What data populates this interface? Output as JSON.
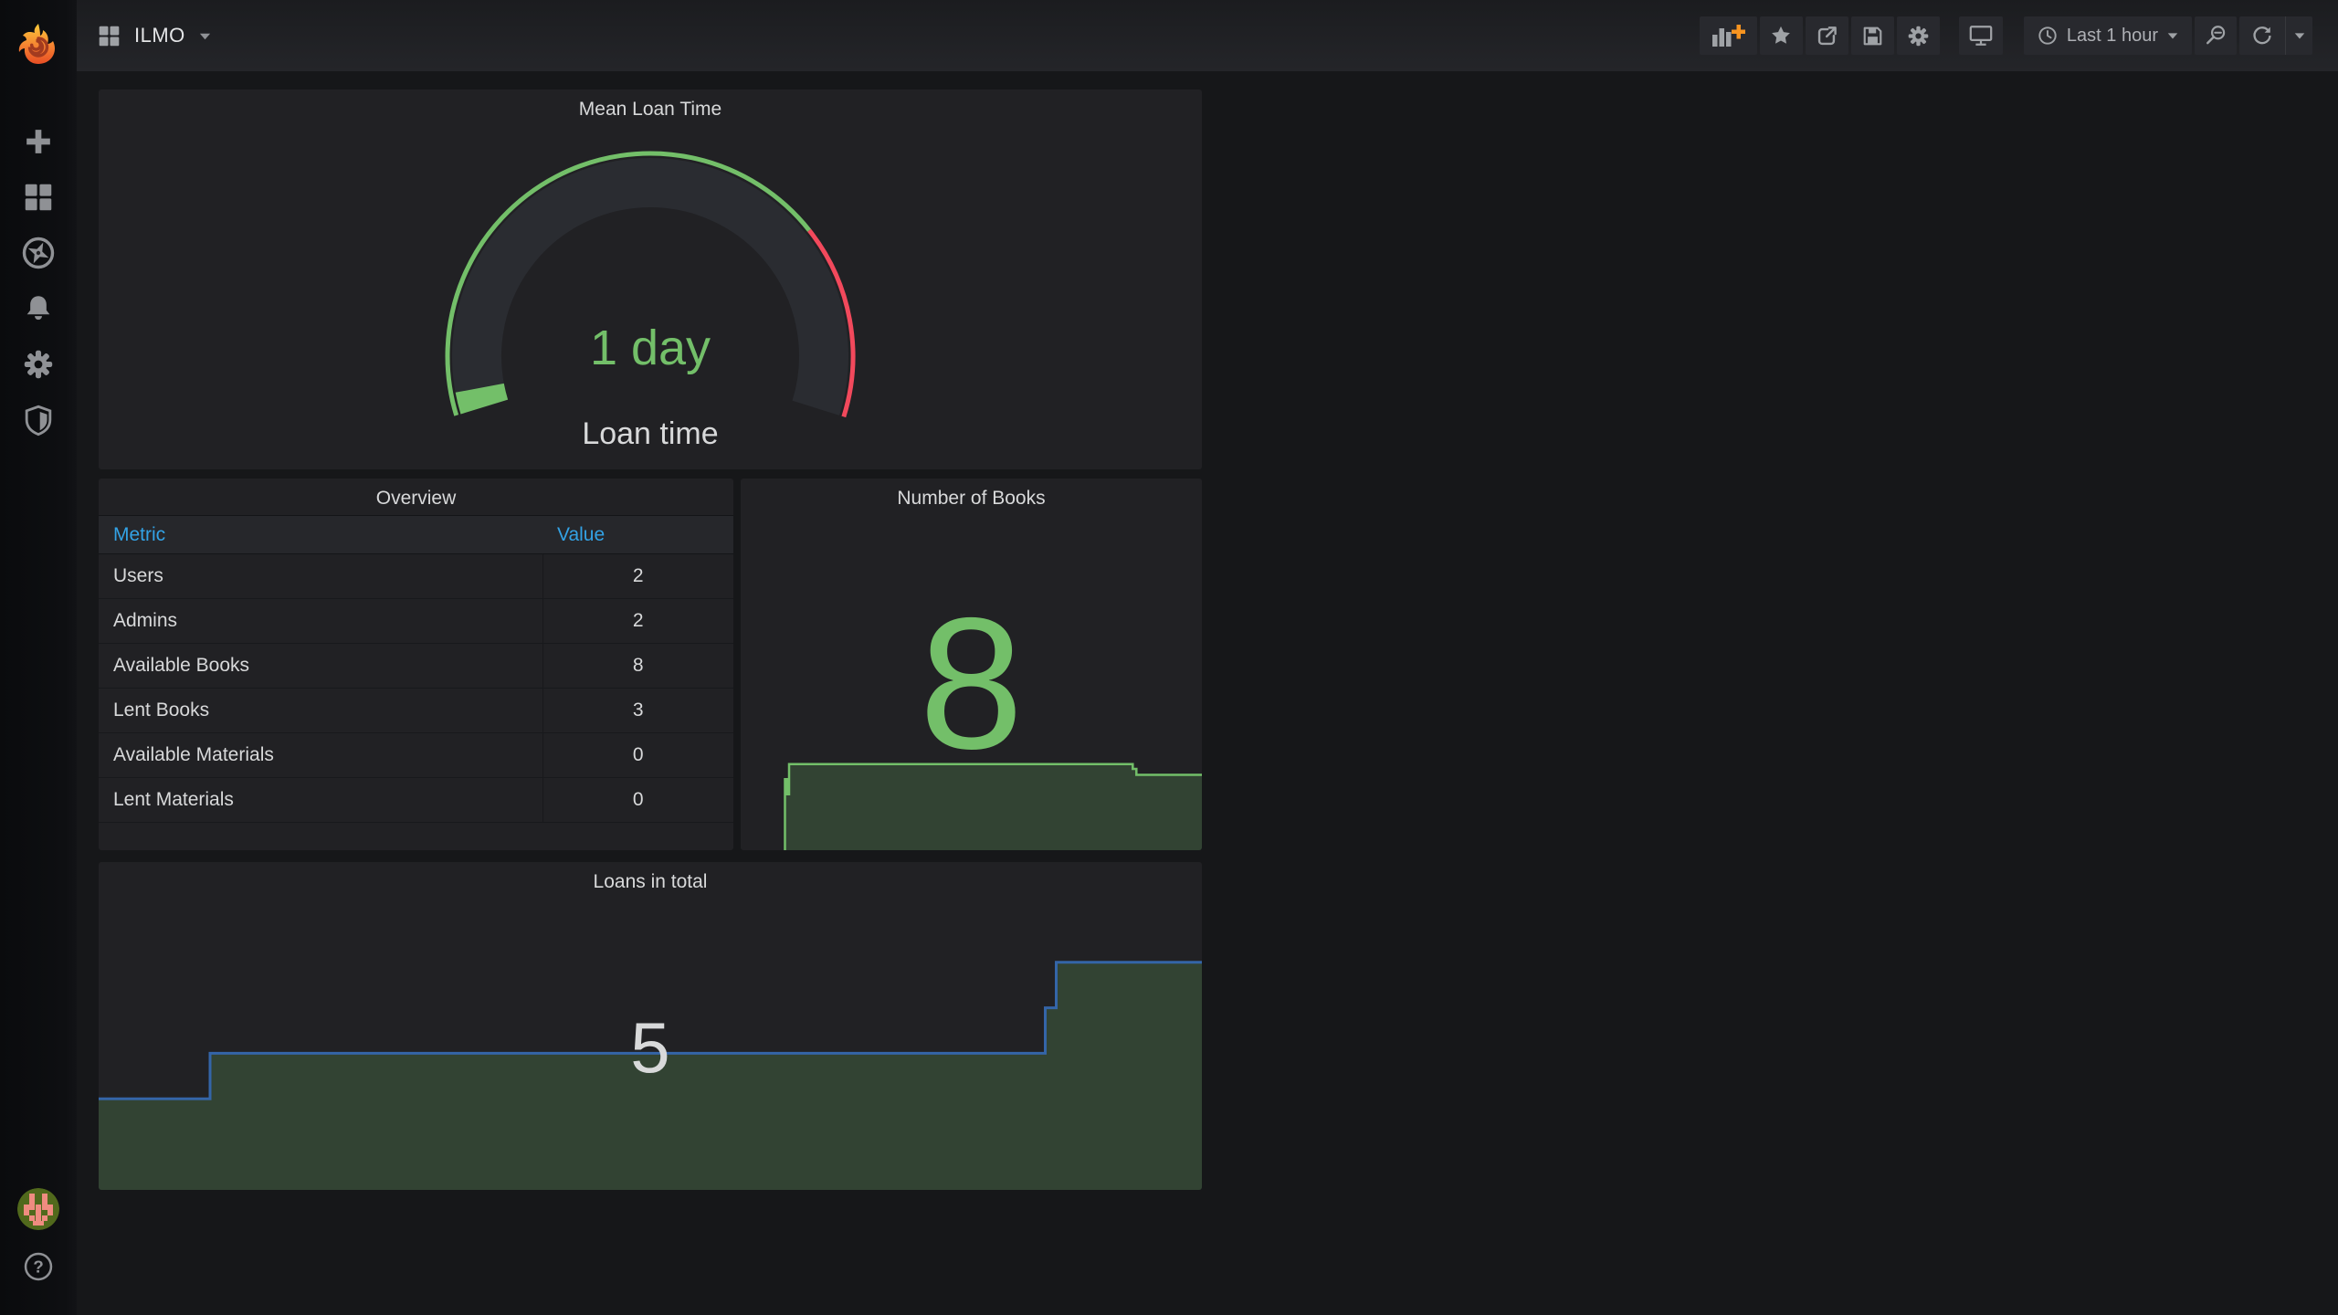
{
  "navbar": {
    "title": "ILMO",
    "time_picker_label": "Last 1 hour",
    "actions": [
      "add-panel",
      "mark-favorite",
      "share-dashboard",
      "save-dashboard",
      "dashboard-settings",
      "cycle-view-mode",
      "time-range-zoom-out",
      "refresh-dashboard",
      "refresh-interval-picker"
    ]
  },
  "sidebar": {
    "items": [
      "create",
      "dashboards",
      "explore",
      "alerting",
      "configuration",
      "server-admin"
    ],
    "bottom_items": [
      "user-avatar",
      "help"
    ]
  },
  "panels": {
    "gauge": {
      "title": "Mean Loan Time",
      "value": "1 day",
      "label": "Loan time"
    },
    "overview": {
      "title": "Overview",
      "columns": [
        "Metric",
        "Value"
      ],
      "rows": [
        [
          "Users",
          "2"
        ],
        [
          "Admins",
          "2"
        ],
        [
          "Available Books",
          "8"
        ],
        [
          "Lent Books",
          "3"
        ],
        [
          "Available Materials",
          "0"
        ],
        [
          "Lent Materials",
          "0"
        ]
      ]
    },
    "books": {
      "title": "Number of Books",
      "value": "8"
    },
    "loans": {
      "title": "Loans in total",
      "value": "5"
    }
  },
  "colors": {
    "green": "#73BF69",
    "red": "#F2495C",
    "gauge_track": "#2A2C31",
    "loans_line": "#3465A8",
    "spark_fill": "rgba(115,191,105,0.22)",
    "table_header_blue": "#33A2E5",
    "panel_bg": "#212124",
    "page_bg": "#161719"
  },
  "chart_data": [
    {
      "id": "mean-loan-time-gauge",
      "type": "gauge",
      "title": "Mean Loan Time",
      "value_text": "1 day",
      "value_label": "Loan time",
      "value_fraction": 0.03,
      "threshold_fraction": 0.74,
      "start_angle": 197,
      "end_angle": -17.4,
      "colors": {
        "ok": "#73BF69",
        "alert": "#F2495C",
        "track": "#2A2C31"
      }
    },
    {
      "id": "number-of-books-spark",
      "type": "area",
      "title": "Number of Books",
      "stat_value": 8,
      "ymax": 9.5,
      "line_color": "#73BF69",
      "fill_color": "rgba(115,191,105,0.22)",
      "line_width": 2.5,
      "points": [
        [
          0.096,
          0
        ],
        [
          0.096,
          6.6
        ],
        [
          0.1,
          6.6
        ],
        [
          0.1,
          5.2
        ],
        [
          0.105,
          5.2
        ],
        [
          0.105,
          8
        ],
        [
          0.85,
          8
        ],
        [
          0.85,
          7.55
        ],
        [
          0.858,
          7.55
        ],
        [
          0.858,
          7
        ],
        [
          1.0,
          7
        ]
      ]
    },
    {
      "id": "loans-in-total-graph",
      "type": "area",
      "title": "Loans in total",
      "stat_value": 5,
      "ymax": 7.2,
      "line_color": "#3465A8",
      "fill_color": "rgba(115,191,105,0.22)",
      "line_width": 3,
      "points": [
        [
          0,
          2
        ],
        [
          0.101,
          2
        ],
        [
          0.101,
          3
        ],
        [
          0.858,
          3
        ],
        [
          0.858,
          4
        ],
        [
          0.868,
          4
        ],
        [
          0.868,
          5
        ],
        [
          1,
          5
        ]
      ]
    }
  ]
}
